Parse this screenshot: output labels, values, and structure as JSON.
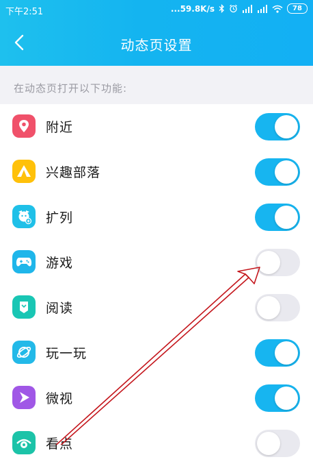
{
  "status_bar": {
    "time": "下午2:51",
    "network_speed": "...59.8K/s",
    "battery": "78"
  },
  "header": {
    "title": "动态页设置"
  },
  "section": {
    "hint": "在动态页打开以下功能:"
  },
  "items": [
    {
      "label": "附近",
      "icon": "location-icon",
      "color": "#f0516a",
      "enabled": true
    },
    {
      "label": "兴趣部落",
      "icon": "tent-icon",
      "color": "#ffc10a",
      "enabled": true
    },
    {
      "label": "扩列",
      "icon": "add-friend-icon",
      "color": "#1fc0e8",
      "enabled": true
    },
    {
      "label": "游戏",
      "icon": "gamepad-icon",
      "color": "#1fb6ea",
      "enabled": false
    },
    {
      "label": "阅读",
      "icon": "book-icon",
      "color": "#19c6b4",
      "enabled": false
    },
    {
      "label": "玩一玩",
      "icon": "planet-icon",
      "color": "#23b9e8",
      "enabled": true
    },
    {
      "label": "微视",
      "icon": "play-icon",
      "color": "#a057e6",
      "enabled": true
    },
    {
      "label": "看点",
      "icon": "eye-icon",
      "color": "#1cc3a8",
      "enabled": false
    }
  ],
  "colors": {
    "accent": "#17b5f0",
    "toggle_off": "#e9e9ef",
    "annotation_arrow": "#c4161c"
  }
}
